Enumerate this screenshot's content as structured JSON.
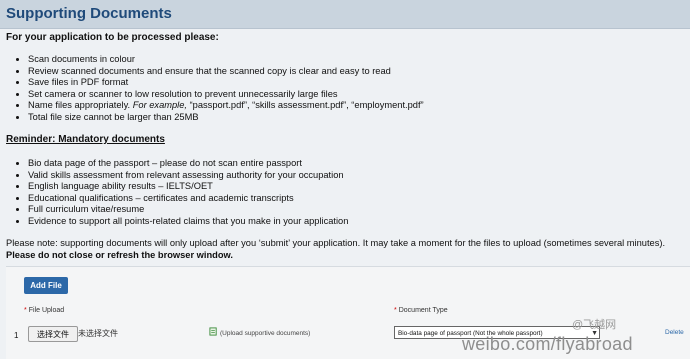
{
  "header": {
    "title": "Supporting Documents"
  },
  "intro": "For your application to be processed please:",
  "list1": [
    "Scan documents in colour",
    "Review scanned documents and ensure that the scanned copy is clear and easy to read",
    "Save files in PDF format",
    "Set camera or scanner to low resolution to prevent unnecessarily large files",
    {
      "prefix": "Name files appropriately. ",
      "italic": "For example,",
      "suffix": " “passport.pdf”, “skills assessment.pdf”, “employment.pdf”"
    },
    "Total file size cannot be larger than 25MB"
  ],
  "reminder": "Reminder: Mandatory documents",
  "list2": [
    "Bio data page of the passport – please do not scan entire passport",
    "Valid skills assessment from relevant assessing authority for your occupation",
    "English language ability results – IELTS/OET",
    "Educational qualifications – certificates and academic transcripts",
    "Full curriculum vitae/resume",
    "Evidence to support all points-related claims that you make in your application"
  ],
  "note": {
    "text": "Please note: supporting documents will only upload after you ‘submit’ your application. It may take a moment for the files to upload (sometimes several minutes). ",
    "strong": "Please do not close or refresh the browser window."
  },
  "upload": {
    "add_file_label": "Add File",
    "file_upload_label": "File Upload",
    "document_type_label": "Document Type",
    "row_number": "1",
    "choose_label": "选择文件",
    "no_file_text": "未选择文件",
    "upload_hint": "(Upload supportive documents)",
    "selected_document_type": "Bio-data page of passport (Not the whole passport)",
    "delete_label": "Delete"
  },
  "watermark": {
    "logo_text": "@飞越网",
    "site_text": "weibo.com/flyabroad"
  }
}
